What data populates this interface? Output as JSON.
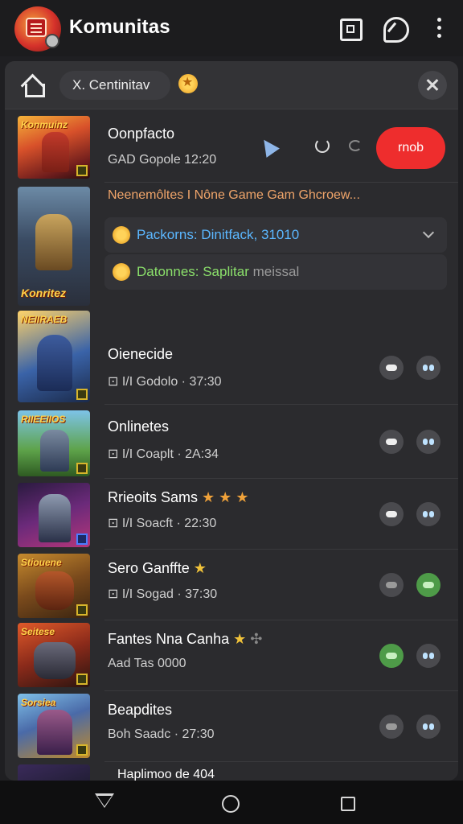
{
  "app": {
    "title": "Komunitas"
  },
  "search": {
    "chip_text": "X. Centinitav"
  },
  "featured": {
    "thumb_label": "Konmuinz",
    "title": "Oonpfacto",
    "subtitle": "GAD Gopole 12:20",
    "cta_label": "rnob"
  },
  "news": {
    "thumb_label": "Konritez",
    "headline": "Neenemôltes I Nône Game Gam Ghcroew...",
    "note1": "Packorns: Dinitfack, 31010",
    "note2": "Datonnes: Saplitar",
    "note2_tail": "meissal"
  },
  "games": [
    {
      "thumb_label": "NEIIRAEB",
      "title": "Oienecide",
      "subtitle": "Godolo · 37:30",
      "prefix": "⊡ I/I",
      "btn1": "default",
      "btn2": "dual"
    },
    {
      "thumb_label": "RIIEEIIOS",
      "title": "Onlinetes",
      "subtitle": "Coaplt · 2A:34",
      "prefix": "⊡ I/I",
      "btn1": "default",
      "btn2": "dual"
    },
    {
      "thumb_label": "",
      "title": "Rrieoits Sams",
      "subtitle": "Soacft · 22:30",
      "prefix": "⊡ I/I",
      "btn1": "default",
      "btn2": "dual"
    },
    {
      "thumb_label": "Stiouene",
      "title": "Sero Ganffte",
      "subtitle": "Sogad · 37:30",
      "prefix": "⊡ I/I",
      "btn1": "default",
      "btn2": "green"
    },
    {
      "thumb_label": "Seitese",
      "title": "Fantes Nna Canha",
      "subtitle": "Aad Tas 0000",
      "prefix": "",
      "btn1": "green",
      "btn2": "dual"
    },
    {
      "thumb_label": "Sorsiea",
      "title": "Beapdites",
      "subtitle": "Boh Saadc · 27:30",
      "prefix": "",
      "btn1": "default",
      "btn2": "dual"
    }
  ],
  "partial_row": {
    "text": "Haplimoo de 404"
  },
  "colors": {
    "accent": "#ee2d2d",
    "panel": "#2b2b2e",
    "note1": "#5bb7ff",
    "note2": "#8be06b",
    "news_headline": "#f0a56a"
  }
}
